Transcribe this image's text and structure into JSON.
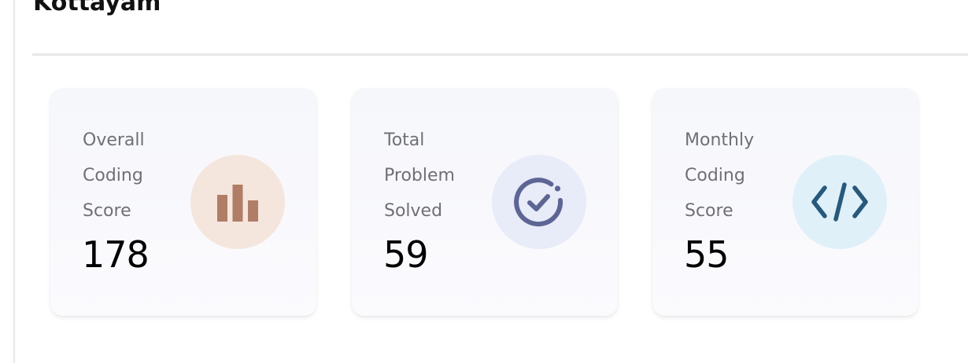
{
  "header": {
    "title": "Kottayam"
  },
  "stats": [
    {
      "label": "Overall\nCoding\nScore",
      "value": "178",
      "icon": "bar-chart-icon",
      "icon_color": "#b07e66",
      "icon_bg": "#f5e6dd"
    },
    {
      "label": "Total\nProblem\nSolved",
      "value": "59",
      "icon": "check-circle-icon",
      "icon_color": "#5d6594",
      "icon_bg": "#e8ebf8"
    },
    {
      "label": "Monthly\nCoding\nScore",
      "value": "55",
      "icon": "code-icon",
      "icon_color": "#27597c",
      "icon_bg": "#dff0f8"
    }
  ]
}
